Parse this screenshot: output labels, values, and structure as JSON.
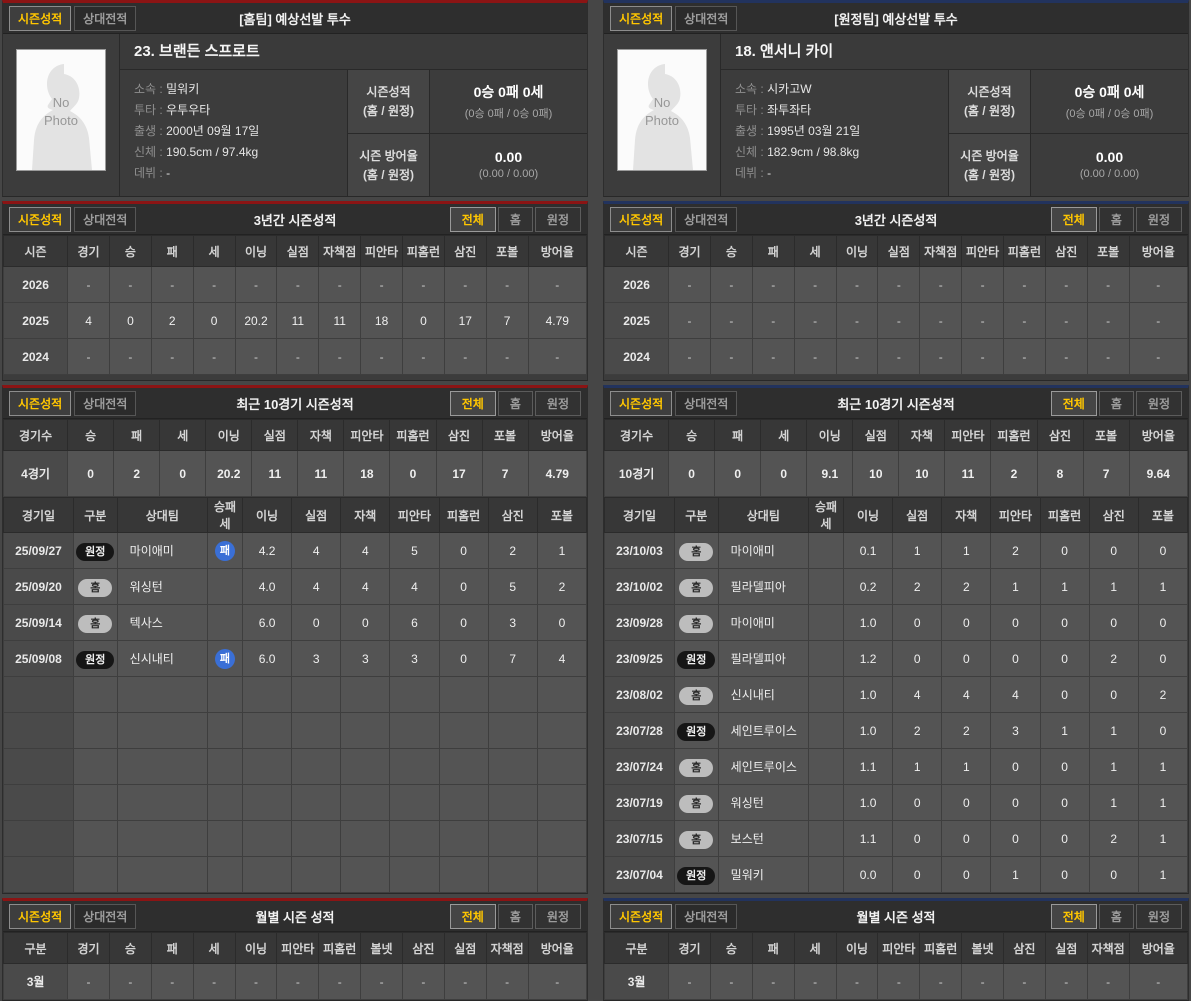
{
  "tabs": {
    "season": "시즌성적",
    "head_to_head": "상대전적"
  },
  "filters": [
    "전체",
    "홈",
    "원정"
  ],
  "colors": {
    "home_accent": "#8b1414",
    "away_accent": "#22335e",
    "active_text": "#ffc600",
    "loss_badge": "#3a6fd6"
  },
  "panels": [
    {
      "id": "home",
      "accent": "#8b1414",
      "title": "[홈팀] 예상선발 투수",
      "player": {
        "name": "23. 브랜든 스프로트",
        "photo_text": "No\nPhoto",
        "details": [
          {
            "label": "소속",
            "value": "밀워키"
          },
          {
            "label": "투타",
            "value": "우투우타"
          },
          {
            "label": "출생",
            "value": "2000년 09월 17일"
          },
          {
            "label": "신체",
            "value": "190.5cm / 97.4kg"
          },
          {
            "label": "데뷔",
            "value": "-"
          }
        ],
        "summary": [
          {
            "label_line1": "시즌성적",
            "label_line2": "(홈 / 원정)",
            "value": "0승 0패 0세",
            "sub": "(0승 0패 / 0승 0패)"
          },
          {
            "label_line1": "시즌 방어율",
            "label_line2": "(홈 / 원정)",
            "value": "0.00",
            "sub": "(0.00 / 0.00)"
          }
        ]
      },
      "three_year": {
        "title": "3년간 시즌성적",
        "columns": [
          "시즌",
          "경기",
          "승",
          "패",
          "세",
          "이닝",
          "실점",
          "자책점",
          "피안타",
          "피홈런",
          "삼진",
          "포볼",
          "방어율"
        ],
        "rows": [
          [
            "2026",
            "-",
            "-",
            "-",
            "-",
            "-",
            "-",
            "-",
            "-",
            "-",
            "-",
            "-",
            "-"
          ],
          [
            "2025",
            "4",
            "0",
            "2",
            "0",
            "20.2",
            "11",
            "11",
            "18",
            "0",
            "17",
            "7",
            "4.79"
          ],
          [
            "2024",
            "-",
            "-",
            "-",
            "-",
            "-",
            "-",
            "-",
            "-",
            "-",
            "-",
            "-",
            "-"
          ]
        ]
      },
      "recent": {
        "title": "최근 10경기 시즌성적",
        "summary_columns": [
          "경기수",
          "승",
          "패",
          "세",
          "이닝",
          "실점",
          "자책",
          "피안타",
          "피홈런",
          "삼진",
          "포볼",
          "방어율"
        ],
        "summary_row": [
          "4경기",
          "0",
          "2",
          "0",
          "20.2",
          "11",
          "11",
          "18",
          "0",
          "17",
          "7",
          "4.79"
        ],
        "log_columns": [
          "경기일",
          "구분",
          "상대팀",
          "승패세",
          "이닝",
          "실점",
          "자책",
          "피안타",
          "피홈런",
          "삼진",
          "포볼"
        ],
        "log_rows": [
          {
            "date": "25/09/27",
            "venue": "원정",
            "opponent": "마이애미",
            "result": "패",
            "stats": [
              "4.2",
              "4",
              "4",
              "5",
              "0",
              "2",
              "1"
            ]
          },
          {
            "date": "25/09/20",
            "venue": "홈",
            "opponent": "워싱턴",
            "result": "",
            "stats": [
              "4.0",
              "4",
              "4",
              "4",
              "0",
              "5",
              "2"
            ]
          },
          {
            "date": "25/09/14",
            "venue": "홈",
            "opponent": "텍사스",
            "result": "",
            "stats": [
              "6.0",
              "0",
              "0",
              "6",
              "0",
              "3",
              "0"
            ]
          },
          {
            "date": "25/09/08",
            "venue": "원정",
            "opponent": "신시내티",
            "result": "패",
            "stats": [
              "6.0",
              "3",
              "3",
              "3",
              "0",
              "7",
              "4"
            ]
          }
        ],
        "empty_rows": 6
      },
      "monthly": {
        "title": "월별 시즌 성적",
        "columns": [
          "구분",
          "경기",
          "승",
          "패",
          "세",
          "이닝",
          "피안타",
          "피홈런",
          "볼넷",
          "삼진",
          "실점",
          "자책점",
          "방어율"
        ],
        "rows": [
          [
            "3월",
            "-",
            "-",
            "-",
            "-",
            "-",
            "-",
            "-",
            "-",
            "-",
            "-",
            "-",
            "-"
          ]
        ]
      }
    },
    {
      "id": "away",
      "accent": "#22335e",
      "title": "[원정팀] 예상선발 투수",
      "player": {
        "name": "18. 앤서니 카이",
        "photo_text": "No\nPhoto",
        "details": [
          {
            "label": "소속",
            "value": "시카고W"
          },
          {
            "label": "투타",
            "value": "좌투좌타"
          },
          {
            "label": "출생",
            "value": "1995년 03월 21일"
          },
          {
            "label": "신체",
            "value": "182.9cm / 98.8kg"
          },
          {
            "label": "데뷔",
            "value": "-"
          }
        ],
        "summary": [
          {
            "label_line1": "시즌성적",
            "label_line2": "(홈 / 원정)",
            "value": "0승 0패 0세",
            "sub": "(0승 0패 / 0승 0패)"
          },
          {
            "label_line1": "시즌 방어율",
            "label_line2": "(홈 / 원정)",
            "value": "0.00",
            "sub": "(0.00 / 0.00)"
          }
        ]
      },
      "three_year": {
        "title": "3년간 시즌성적",
        "columns": [
          "시즌",
          "경기",
          "승",
          "패",
          "세",
          "이닝",
          "실점",
          "자책점",
          "피안타",
          "피홈런",
          "삼진",
          "포볼",
          "방어율"
        ],
        "rows": [
          [
            "2026",
            "-",
            "-",
            "-",
            "-",
            "-",
            "-",
            "-",
            "-",
            "-",
            "-",
            "-",
            "-"
          ],
          [
            "2025",
            "-",
            "-",
            "-",
            "-",
            "-",
            "-",
            "-",
            "-",
            "-",
            "-",
            "-",
            "-"
          ],
          [
            "2024",
            "-",
            "-",
            "-",
            "-",
            "-",
            "-",
            "-",
            "-",
            "-",
            "-",
            "-",
            "-"
          ]
        ]
      },
      "recent": {
        "title": "최근 10경기 시즌성적",
        "summary_columns": [
          "경기수",
          "승",
          "패",
          "세",
          "이닝",
          "실점",
          "자책",
          "피안타",
          "피홈런",
          "삼진",
          "포볼",
          "방어율"
        ],
        "summary_row": [
          "10경기",
          "0",
          "0",
          "0",
          "9.1",
          "10",
          "10",
          "11",
          "2",
          "8",
          "7",
          "9.64"
        ],
        "log_columns": [
          "경기일",
          "구분",
          "상대팀",
          "승패세",
          "이닝",
          "실점",
          "자책",
          "피안타",
          "피홈런",
          "삼진",
          "포볼"
        ],
        "log_rows": [
          {
            "date": "23/10/03",
            "venue": "홈",
            "opponent": "마이애미",
            "result": "",
            "stats": [
              "0.1",
              "1",
              "1",
              "2",
              "0",
              "0",
              "0"
            ]
          },
          {
            "date": "23/10/02",
            "venue": "홈",
            "opponent": "필라델피아",
            "result": "",
            "stats": [
              "0.2",
              "2",
              "2",
              "1",
              "1",
              "1",
              "1"
            ]
          },
          {
            "date": "23/09/28",
            "venue": "홈",
            "opponent": "마이애미",
            "result": "",
            "stats": [
              "1.0",
              "0",
              "0",
              "0",
              "0",
              "0",
              "0"
            ]
          },
          {
            "date": "23/09/25",
            "venue": "원정",
            "opponent": "필라델피아",
            "result": "",
            "stats": [
              "1.2",
              "0",
              "0",
              "0",
              "0",
              "2",
              "0"
            ]
          },
          {
            "date": "23/08/02",
            "venue": "홈",
            "opponent": "신시내티",
            "result": "",
            "stats": [
              "1.0",
              "4",
              "4",
              "4",
              "0",
              "0",
              "2"
            ]
          },
          {
            "date": "23/07/28",
            "venue": "원정",
            "opponent": "세인트루이스",
            "result": "",
            "stats": [
              "1.0",
              "2",
              "2",
              "3",
              "1",
              "1",
              "0"
            ]
          },
          {
            "date": "23/07/24",
            "venue": "홈",
            "opponent": "세인트루이스",
            "result": "",
            "stats": [
              "1.1",
              "1",
              "1",
              "0",
              "0",
              "1",
              "1"
            ]
          },
          {
            "date": "23/07/19",
            "venue": "홈",
            "opponent": "워싱턴",
            "result": "",
            "stats": [
              "1.0",
              "0",
              "0",
              "0",
              "0",
              "1",
              "1"
            ]
          },
          {
            "date": "23/07/15",
            "venue": "홈",
            "opponent": "보스턴",
            "result": "",
            "stats": [
              "1.1",
              "0",
              "0",
              "0",
              "0",
              "2",
              "1"
            ]
          },
          {
            "date": "23/07/04",
            "venue": "원정",
            "opponent": "밀워키",
            "result": "",
            "stats": [
              "0.0",
              "0",
              "0",
              "1",
              "0",
              "0",
              "1"
            ]
          }
        ],
        "empty_rows": 0
      },
      "monthly": {
        "title": "월별 시즌 성적",
        "columns": [
          "구분",
          "경기",
          "승",
          "패",
          "세",
          "이닝",
          "피안타",
          "피홈런",
          "볼넷",
          "삼진",
          "실점",
          "자책점",
          "방어율"
        ],
        "rows": [
          [
            "3월",
            "-",
            "-",
            "-",
            "-",
            "-",
            "-",
            "-",
            "-",
            "-",
            "-",
            "-",
            "-"
          ]
        ]
      }
    }
  ]
}
